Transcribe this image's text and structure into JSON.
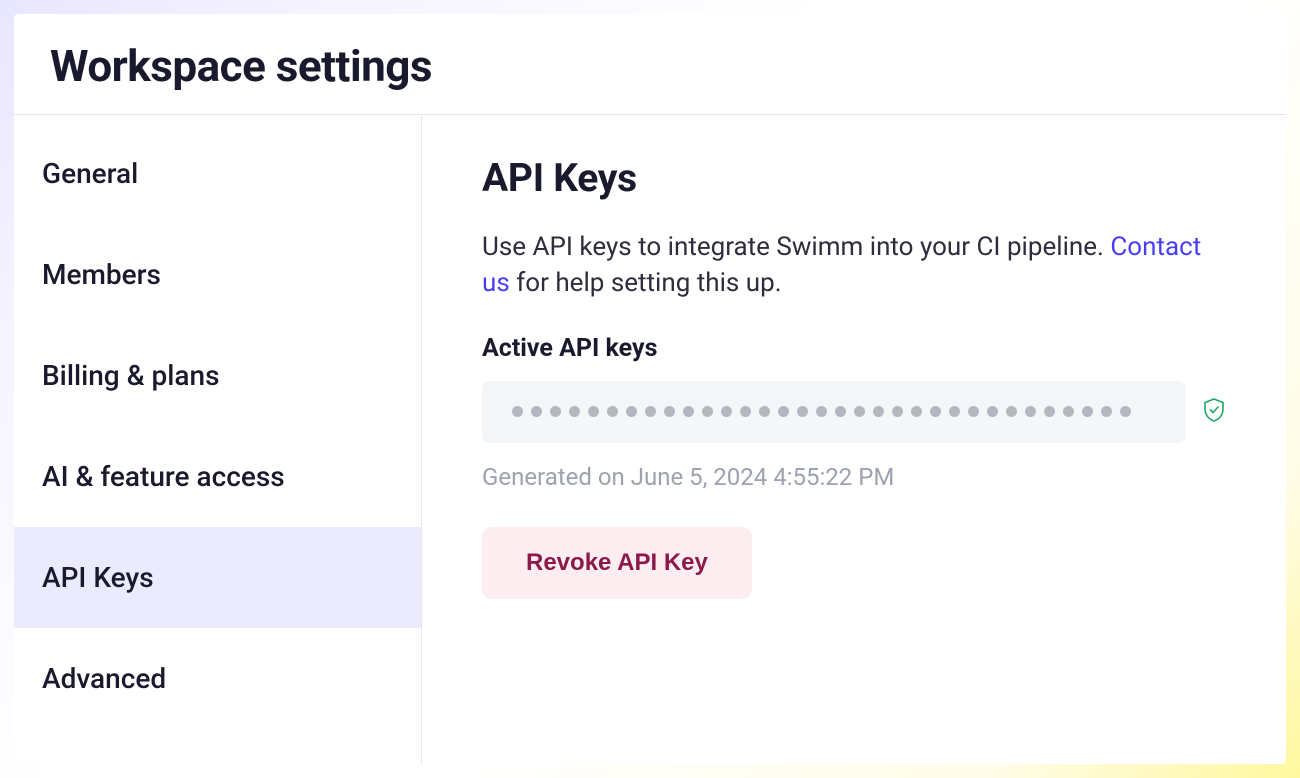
{
  "header": {
    "title": "Workspace settings"
  },
  "sidebar": {
    "items": [
      {
        "label": "General",
        "active": false
      },
      {
        "label": "Members",
        "active": false
      },
      {
        "label": "Billing & plans",
        "active": false
      },
      {
        "label": "AI & feature access",
        "active": false
      },
      {
        "label": "API Keys",
        "active": true
      },
      {
        "label": "Advanced",
        "active": false
      }
    ]
  },
  "main": {
    "title": "API Keys",
    "description_part1": "Use API keys to integrate Swimm into your CI pipeline. ",
    "contact_link": "Contact us",
    "description_part2": " for help setting this up.",
    "active_label": "Active API keys",
    "masked_key_dots": 33,
    "generated_text": "Generated on June 5, 2024 4:55:22 PM",
    "revoke_button": "Revoke API Key"
  }
}
